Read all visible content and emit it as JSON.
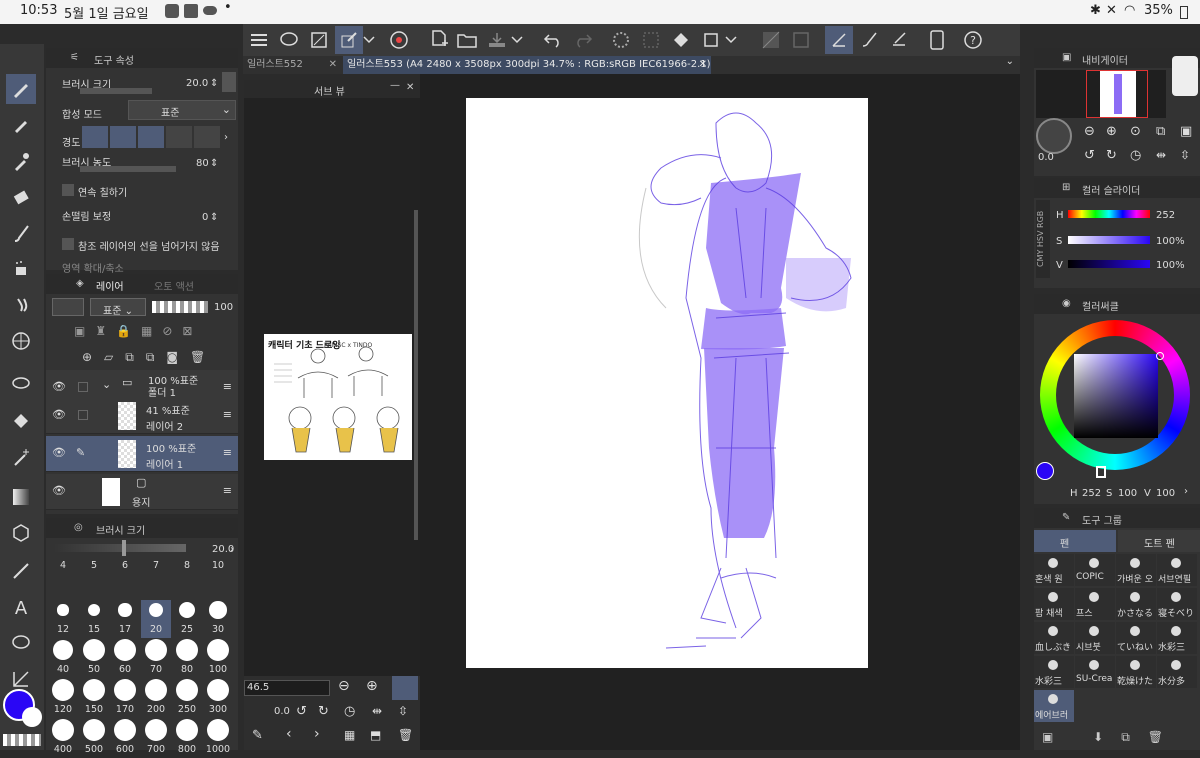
{
  "status": {
    "time": "10:53",
    "date": "5월 1일 금요일",
    "battery": "35%"
  },
  "tabs": [
    {
      "label": "일러스트552"
    },
    {
      "label": "일러스트553 (A4 2480 x 3508px 300dpi 34.7% : RGB:sRGB IEC61966-2.1)"
    }
  ],
  "tool_property": {
    "title": "도구 속성",
    "brush_size_label": "브러시 크기",
    "brush_size": "20.0",
    "blend_label": "합성 모드",
    "blend_value": "표준",
    "hardness_label": "경도",
    "density_label": "브러시 농도",
    "density": "80",
    "continuous_label": "연속 칠하기",
    "stabilization_label": "손떨림 보정",
    "stabilization": "0",
    "ref_label": "참조 레이어의 선을 넘어가지 않음",
    "zoom_label": "영역 확대/축소"
  },
  "layers": {
    "tab": "레이어",
    "tab2": "오토 액션",
    "blend": "표준",
    "opacity": "100",
    "items": [
      {
        "mode": "100 %표준",
        "name": "폴더 1"
      },
      {
        "mode": "41 %표준",
        "name": "레이어 2"
      },
      {
        "mode": "100 %표준",
        "name": "레이어 1"
      },
      {
        "mode": "",
        "name": "용지"
      }
    ]
  },
  "brush_size_panel": {
    "title": "브러시 크기",
    "value": "20.0",
    "sizes": [
      "4",
      "5",
      "6",
      "7",
      "8",
      "10",
      "12",
      "15",
      "17",
      "20",
      "25",
      "30",
      "40",
      "50",
      "60",
      "70",
      "80",
      "100",
      "120",
      "150",
      "170",
      "200",
      "250",
      "300",
      "400",
      "500",
      "600",
      "700",
      "800",
      "1000"
    ]
  },
  "subview": {
    "title": "서브 뷰",
    "zoom": "46.5",
    "rotation": "0.0",
    "ref_title": "캐릭터 기초 드로잉",
    "ref_sub": "PAINSC x TINDO"
  },
  "navigator": {
    "title": "내비게이터",
    "rotation": "0.0"
  },
  "color_slider": {
    "title": "컬러 슬라이더",
    "modes": [
      "RGB",
      "HSV",
      "CMY"
    ],
    "h_label": "H",
    "h": "252",
    "s_label": "S",
    "s": "100%",
    "v_label": "V",
    "v": "100%"
  },
  "color_circle": {
    "title": "컬러써클",
    "h_label": "H",
    "h": "252",
    "s_label": "S",
    "s": "100",
    "v_label": "V",
    "v": "100"
  },
  "tool_group": {
    "title": "도구 그룹",
    "tab1": "펜",
    "tab2": "도트 펜",
    "items": [
      "혼색 원",
      "COPIC",
      "가벼운 오",
      "서브연필",
      "팜 채색",
      "프스",
      "かさなる",
      "寝そべり",
      "血しぶき",
      "시브붓",
      "ていねい",
      "水彩三",
      "水彩三",
      "SU-Crea",
      "乾燥けた",
      "水分多",
      "에어브러"
    ]
  },
  "colors": {
    "main": "#2a06f5",
    "accent": "#4f5c78",
    "sketch": "#8c6cf5"
  }
}
